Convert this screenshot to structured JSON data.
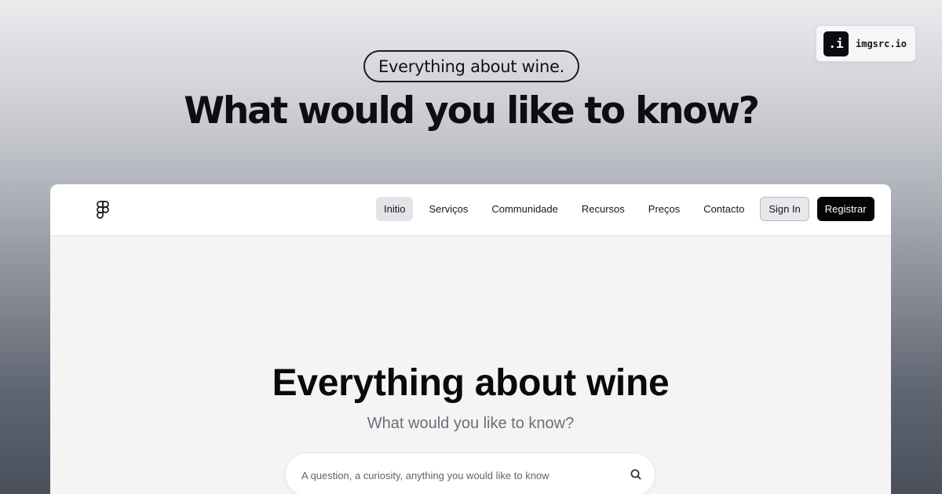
{
  "banner": {
    "pill_text": "Everything about wine.",
    "headline": "What would you like to know?"
  },
  "brand": {
    "mark": ".i",
    "name": "imgsrc.io"
  },
  "nav": {
    "logo_icon": "figma-icon",
    "links": [
      {
        "label": "Initio",
        "active": true
      },
      {
        "label": "Serviços"
      },
      {
        "label": "Communidade"
      },
      {
        "label": "Recursos"
      },
      {
        "label": "Preços"
      },
      {
        "label": "Contacto"
      }
    ],
    "signin_label": "Sign In",
    "register_label": "Registrar"
  },
  "hero": {
    "title": "Everything about wine",
    "subtitle": "What would you like to know?"
  },
  "search": {
    "placeholder": "A question, a curiosity, anything you would like to know",
    "value": "",
    "icon": "search-icon"
  },
  "colors": {
    "primary": "#050507",
    "active_nav_bg": "#e3e4e8",
    "subtitle": "#6b6f78"
  }
}
